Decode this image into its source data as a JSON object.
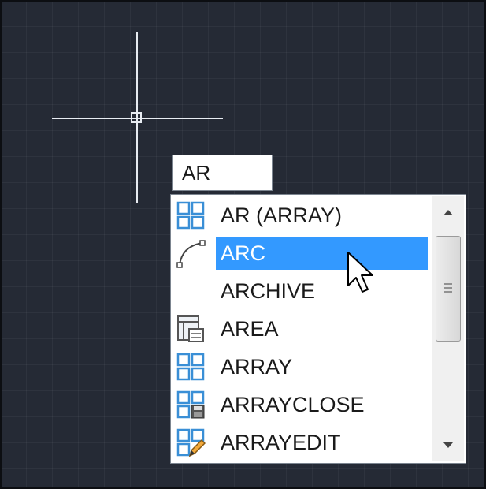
{
  "command_input": {
    "value": "AR"
  },
  "autocomplete": {
    "items": [
      {
        "label": "AR (ARRAY)",
        "icon": "array-icon"
      },
      {
        "label": "ARC",
        "icon": "arc-icon",
        "selected": true
      },
      {
        "label": "ARCHIVE",
        "icon": ""
      },
      {
        "label": "AREA",
        "icon": "area-icon"
      },
      {
        "label": "ARRAY",
        "icon": "array-icon"
      },
      {
        "label": "ARRAYCLOSE",
        "icon": "arrayclose-icon"
      },
      {
        "label": "ARRAYEDIT",
        "icon": "arrayedit-icon"
      }
    ]
  },
  "colors": {
    "canvas_background": "#252a35",
    "selection": "#3399ff",
    "icon_blue": "#3a8fd6"
  }
}
